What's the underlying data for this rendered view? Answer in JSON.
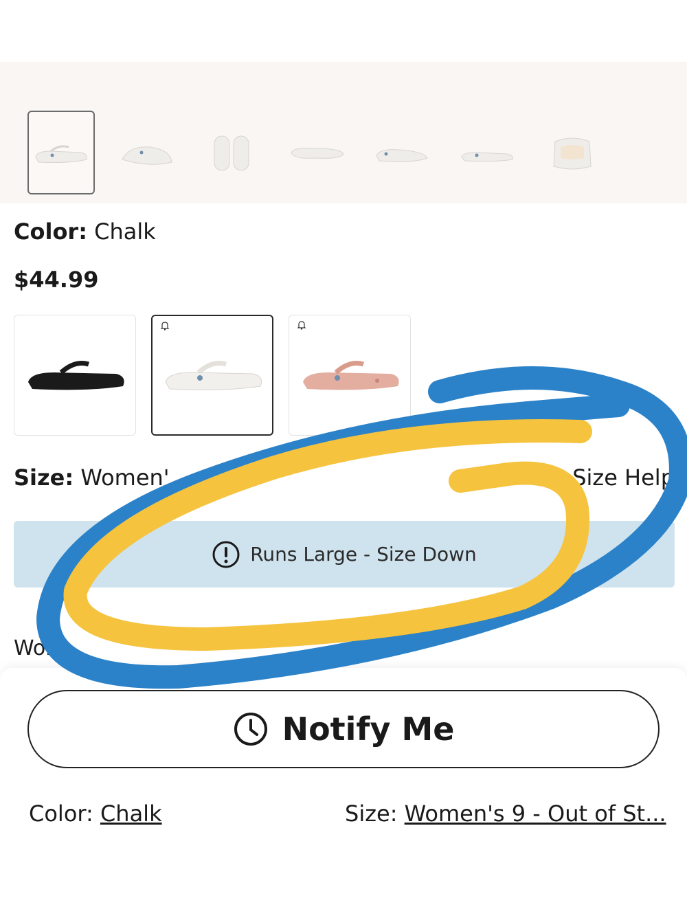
{
  "product": {
    "color_label": "Color:",
    "color_value": "Chalk",
    "price": "$44.99"
  },
  "gallery": {
    "thumbnail_count": 7,
    "selected_index": 0
  },
  "swatches": [
    {
      "color_hex": "#1a1a1a",
      "notify_bell": false
    },
    {
      "color_hex": "#f2f0ec",
      "notify_bell": true
    },
    {
      "color_hex": "#e3ada0",
      "notify_bell": true
    }
  ],
  "size": {
    "label": "Size:",
    "value_visible": "Women'",
    "help_link": "Size Help"
  },
  "fit_notice": "Runs Large - Size Down",
  "womens_partial": "Wom",
  "notify_button": "Notify Me",
  "footer": {
    "color_label": "Color:",
    "color_value": "Chalk",
    "size_label": "Size:",
    "size_value": "Women's 9 - Out of St..."
  },
  "annotation_colors": {
    "blue": "#2b82c9",
    "yellow": "#f6c33f"
  }
}
